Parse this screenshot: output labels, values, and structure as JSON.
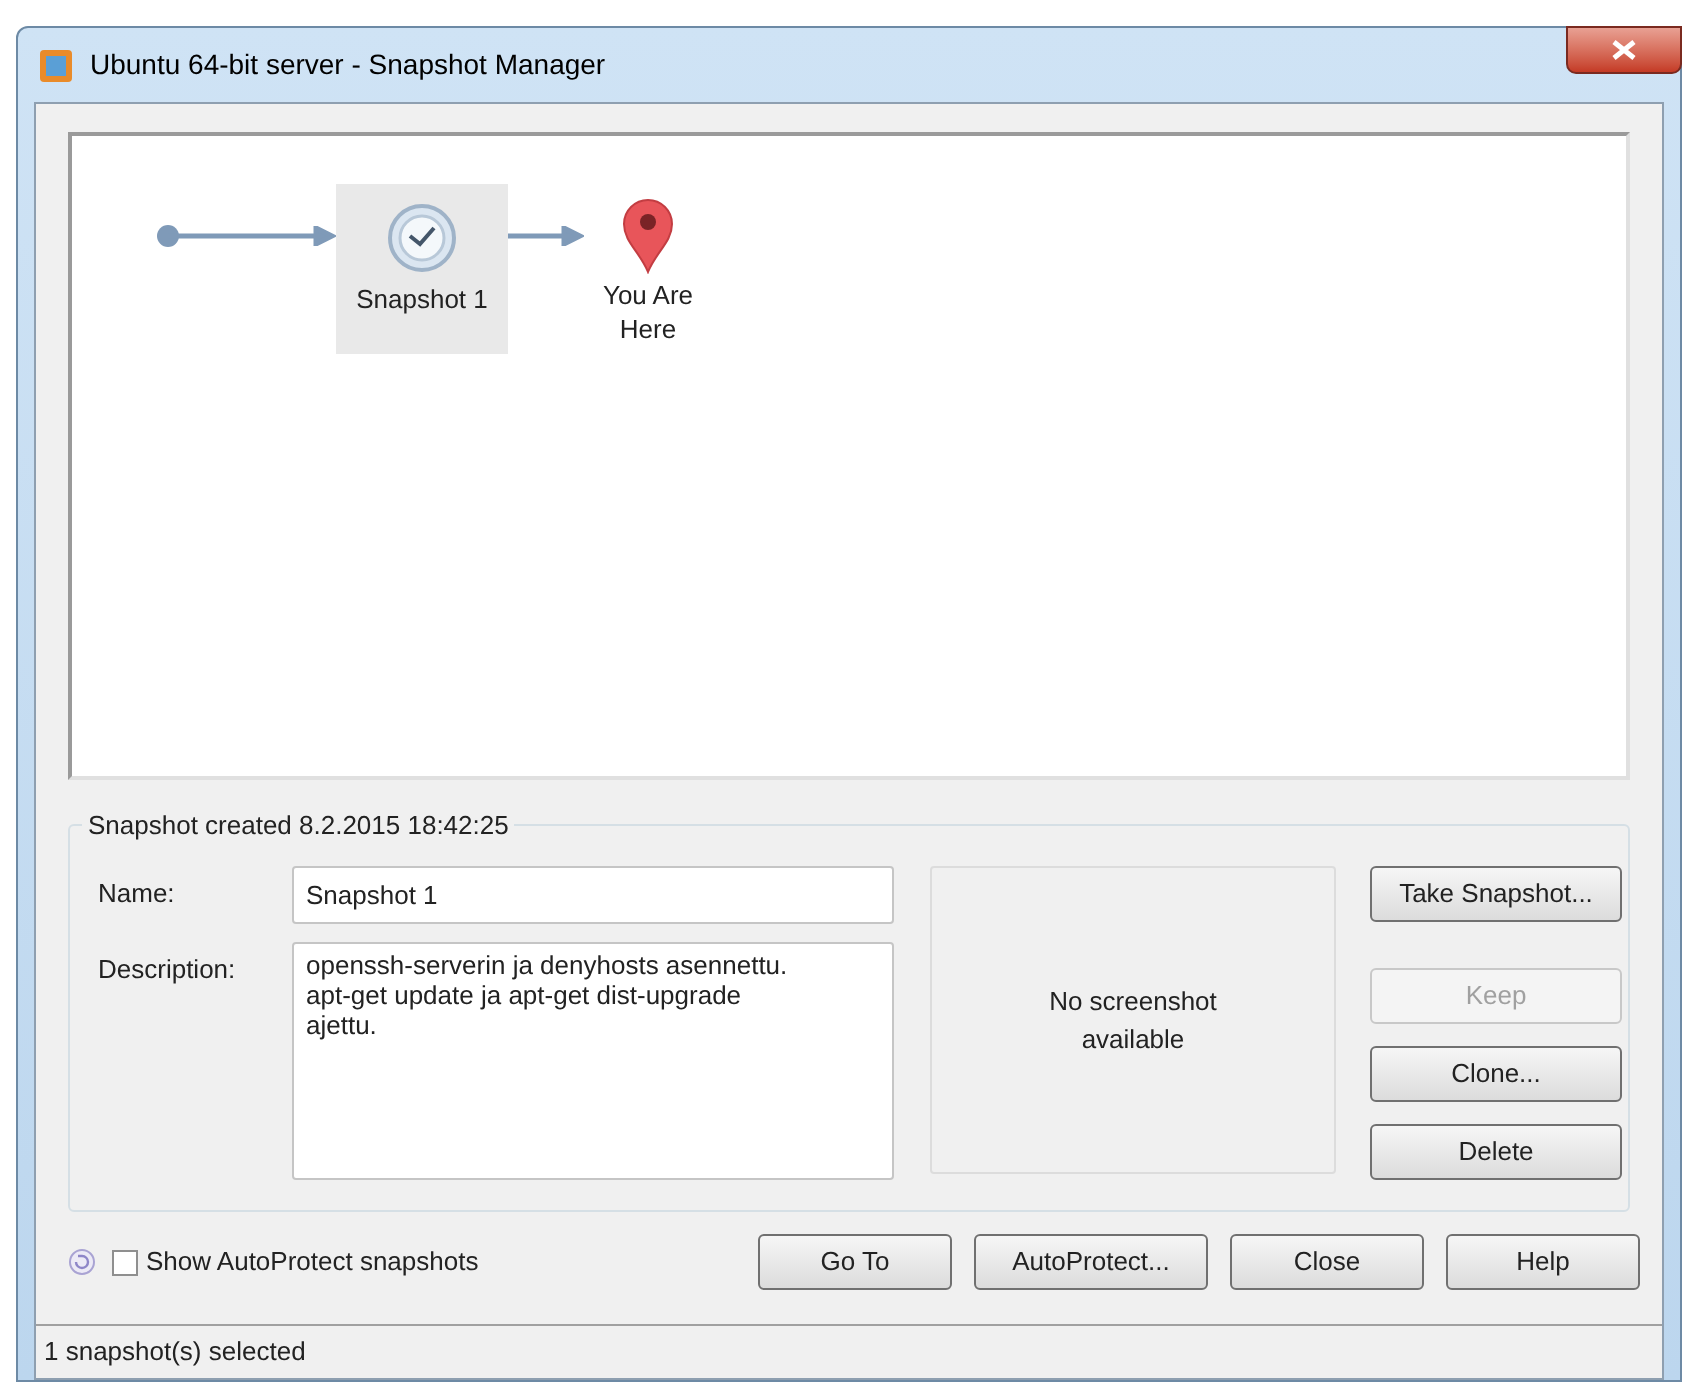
{
  "window": {
    "title": "Ubuntu 64-bit server - Snapshot Manager"
  },
  "tree": {
    "nodes": [
      {
        "kind": "snapshot",
        "label": "Snapshot 1",
        "selected": true
      },
      {
        "kind": "current",
        "label": "You Are Here",
        "selected": false
      }
    ]
  },
  "details": {
    "group_title": "Snapshot created 8.2.2015 18:42:25",
    "name_label": "Name:",
    "name_value": "Snapshot 1",
    "description_label": "Description:",
    "description_value": "openssh-serverin ja denyhosts asennettu.\napt-get update ja apt-get dist-upgrade\najettu.",
    "screenshot_text": "No screenshot available",
    "side_buttons": [
      {
        "label": "Take Snapshot...",
        "disabled": false
      },
      {
        "label": "Keep",
        "disabled": true
      },
      {
        "label": "Clone...",
        "disabled": false
      },
      {
        "label": "Delete",
        "disabled": false
      }
    ]
  },
  "autoprotect_checkbox": {
    "label": "Show AutoProtect snapshots",
    "checked": false
  },
  "bottom_buttons": [
    {
      "label": "Go To",
      "disabled": false
    },
    {
      "label": "AutoProtect...",
      "disabled": false
    },
    {
      "label": "Close",
      "disabled": false
    },
    {
      "label": "Help",
      "disabled": false
    }
  ],
  "status_bar": "1 snapshot(s) selected"
}
